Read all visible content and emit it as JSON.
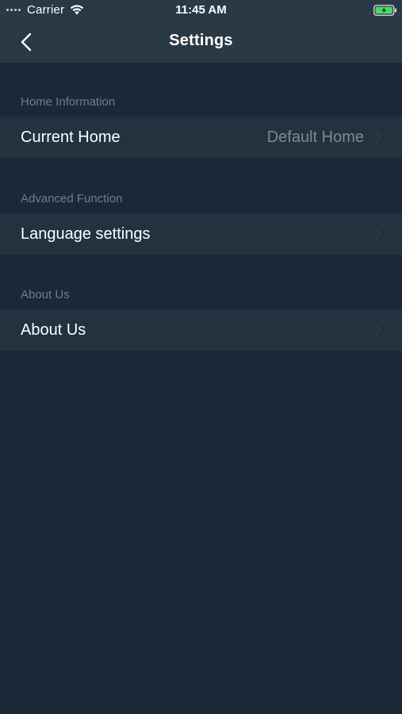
{
  "status_bar": {
    "carrier": "Carrier",
    "time": "11:45 AM",
    "signal_icon": "signal-dots-icon",
    "wifi_icon": "wifi-icon",
    "battery_icon": "battery-charging-icon",
    "battery_color": "#4cd964"
  },
  "nav": {
    "title": "Settings",
    "back_icon": "chevron-left-icon"
  },
  "sections": [
    {
      "header": "Home Information",
      "rows": [
        {
          "label": "Current Home",
          "value": "Default Home"
        }
      ]
    },
    {
      "header": "Advanced Function",
      "rows": [
        {
          "label": "Language settings"
        }
      ]
    },
    {
      "header": "About Us",
      "rows": [
        {
          "label": "About Us"
        }
      ]
    }
  ],
  "colors": {
    "background": "#1a2837",
    "nav_background": "#2a3946",
    "row_background": "#22323f",
    "section_header_text": "#6e7d89",
    "secondary_value_text": "#7c8994",
    "primary_text": "#ffffff"
  }
}
